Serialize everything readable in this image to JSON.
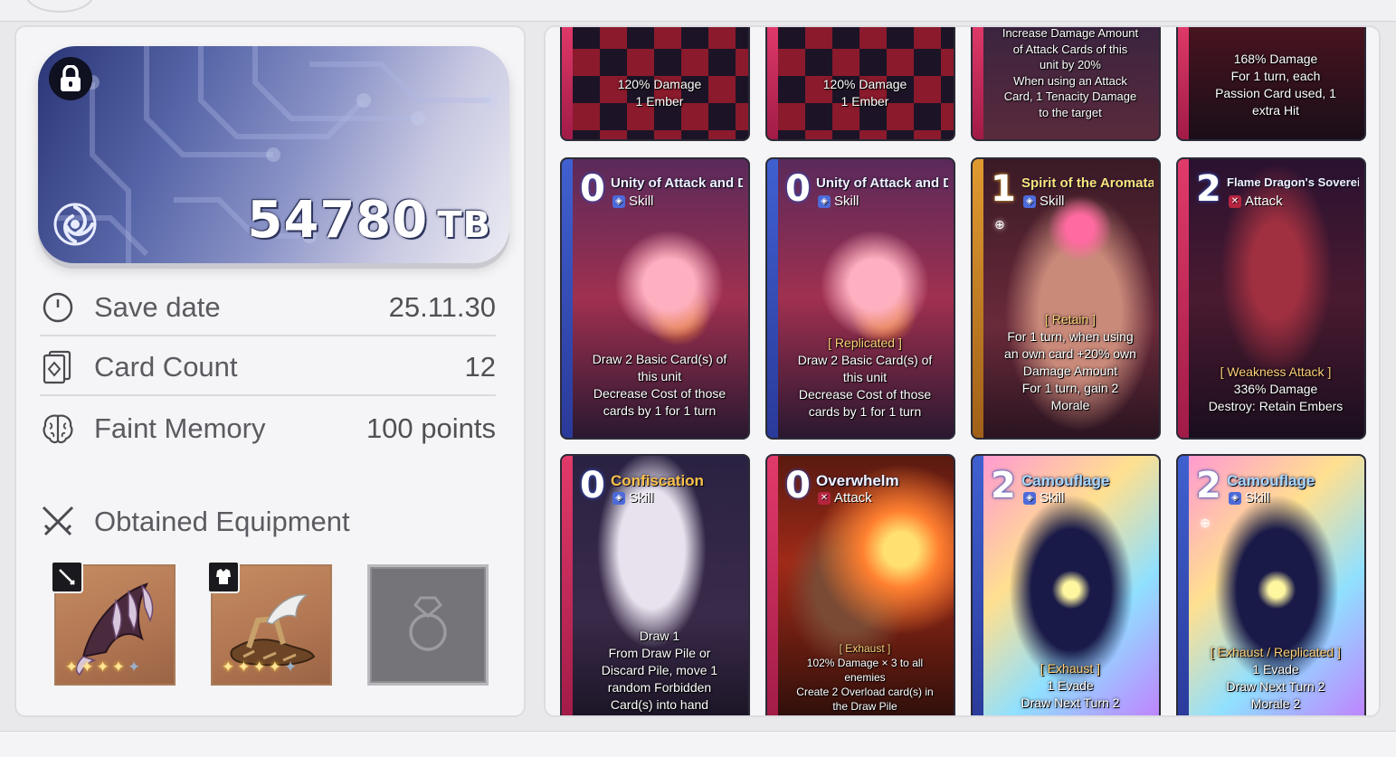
{
  "save": {
    "tb_value": "54780",
    "tb_unit": "TB"
  },
  "info": [
    {
      "icon": "clock-icon",
      "label": "Save date",
      "value": "25.11.30"
    },
    {
      "icon": "card-icon",
      "label": "Card Count",
      "value": "12"
    },
    {
      "icon": "brain-icon",
      "label": "Faint Memory",
      "value": "100 points"
    }
  ],
  "equipment": {
    "title": "Obtained Equipment",
    "slots": [
      {
        "type_icon": "sword-icon",
        "item": "claw-weapon",
        "stars": 4,
        "max_stars": 5
      },
      {
        "type_icon": "armor-icon",
        "item": "winged-sandals",
        "stars": 4,
        "max_stars": 5
      },
      {
        "type_icon": "ring-icon",
        "item": "empty",
        "stars": 0,
        "max_stars": 0
      }
    ]
  },
  "cards_top_row": [
    {
      "desc": [
        "120% Damage",
        "1 Ember"
      ]
    },
    {
      "desc": [
        "120% Damage",
        "1 Ember"
      ]
    },
    {
      "desc": [
        "Increase Damage Amount",
        "of Attack Cards of this",
        "unit by 20%",
        "When using an Attack",
        "Card, 1 Tenacity Damage",
        "to the target"
      ]
    },
    {
      "desc": [
        "168% Damage",
        "For 1 turn, each",
        "Passion Card used, 1",
        "extra Hit"
      ]
    }
  ],
  "cards": [
    {
      "cost": "0",
      "name": "Unity of Attack and Defense",
      "type": "Skill",
      "tag": "",
      "desc": [
        "Draw 2 Basic Card(s) of",
        "this unit",
        "Decrease Cost of those",
        "cards by 1 for 1 turn"
      ]
    },
    {
      "cost": "0",
      "name": "Unity of Attack and Defense",
      "type": "Skill",
      "tag": "[ Replicated ]",
      "desc": [
        "Draw 2 Basic Card(s) of",
        "this unit",
        "Decrease Cost of those",
        "cards by 1 for 1 turn"
      ]
    },
    {
      "cost": "1",
      "name": "Spirit of the Aromata",
      "type": "Skill",
      "tag": "[ Retain ]",
      "desc": [
        "For 1 turn, when using",
        "an own card +20% own",
        "Damage Amount",
        "For 1 turn, gain 2",
        "Morale"
      ]
    },
    {
      "cost": "2",
      "name": "Flame Dragon's Sovereignty",
      "type": "Attack",
      "tag": "[ Weakness Attack ]",
      "desc": [
        "336% Damage",
        "Destroy: Retain Embers"
      ]
    },
    {
      "cost": "0",
      "name": "Confiscation",
      "type": "Skill",
      "tag": "",
      "desc": [
        "Draw 1",
        "From Draw Pile or",
        "Discard Pile, move 1",
        "random Forbidden",
        "Card(s) into hand"
      ]
    },
    {
      "cost": "0",
      "name": "Overwhelm",
      "type": "Attack",
      "tag": "[ Exhaust ]",
      "desc": [
        "102% Damage × 3 to all",
        "enemies",
        "Create 2 Overload card(s) in",
        "the Draw Pile"
      ]
    },
    {
      "cost": "2",
      "name": "Camouflage",
      "type": "Skill",
      "tag": "[ Exhaust ]",
      "desc": [
        "1 Evade",
        "Draw Next Turn 2"
      ]
    },
    {
      "cost": "2",
      "name": "Camouflage",
      "type": "Skill",
      "tag": "[ Exhaust / Replicated ]",
      "desc": [
        "1 Evade",
        "Draw Next Turn 2",
        "Morale 2"
      ]
    }
  ],
  "colors": {
    "card_frame": "#e13a6a",
    "highlight_blue": "#8fc3ff",
    "tag_gold": "#ffcf7a",
    "skill_icon": "#4d6ad9",
    "attack_icon": "#b5243e"
  }
}
